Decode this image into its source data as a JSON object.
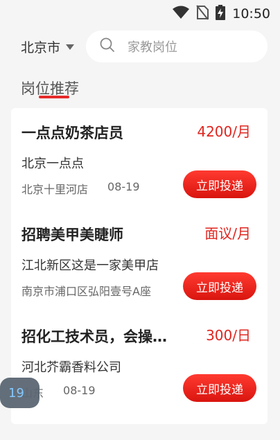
{
  "status_bar": {
    "time": "10:50",
    "icons": [
      "wifi-icon",
      "no-sim-icon",
      "battery-charging-icon"
    ]
  },
  "header": {
    "city": "北京市",
    "search_placeholder": "家教岗位"
  },
  "section": {
    "title": "岗位推荐"
  },
  "jobs": [
    {
      "title": "一点点奶茶店员",
      "salary": "4200/月",
      "company": "北京一点点",
      "location": "北京十里河店",
      "date": "08-19",
      "apply_label": "立即投递"
    },
    {
      "title": "招聘美甲美睫师",
      "salary": "面议/月",
      "company": "江北新区这是一家美甲店",
      "location": "南京市浦口区弘阳壹号A座",
      "date": "",
      "apply_label": "立即投递"
    },
    {
      "title": "招化工技术员，会操作液相",
      "salary": "300/日",
      "company": "河北芥霸香料公司",
      "location": "山东",
      "date": "08-19",
      "apply_label": "立即投递"
    }
  ],
  "float_badge": {
    "text": "19"
  },
  "colors": {
    "accent": "#e0251f",
    "background": "#f5f5f5"
  }
}
